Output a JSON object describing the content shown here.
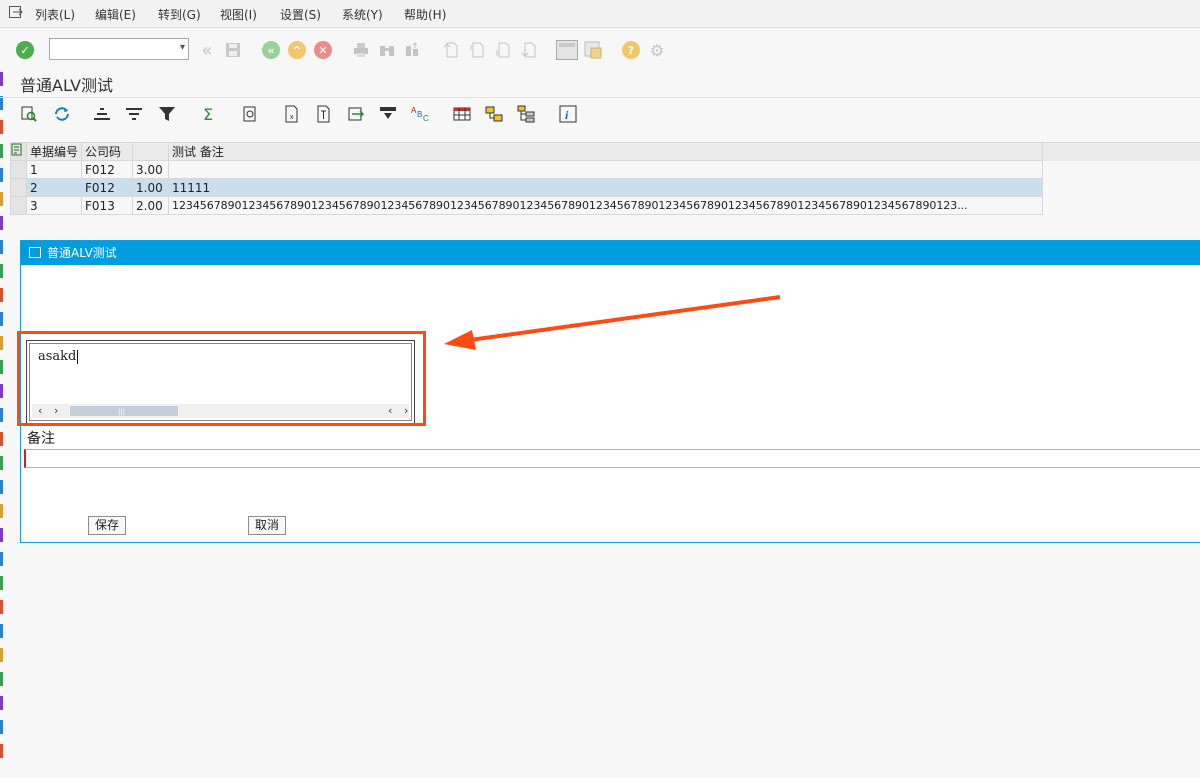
{
  "menu": {
    "items": [
      "列表(L)",
      "编辑(E)",
      "转到(G)",
      "视图(I)",
      "设置(S)",
      "系统(Y)",
      "帮助(H)"
    ]
  },
  "toolbar": {
    "command_field_value": "",
    "icons": [
      "enter-check",
      "dropdown",
      "back-double",
      "save",
      "back",
      "exit",
      "cancel",
      "print",
      "find",
      "find-next",
      "first-page",
      "prev-page",
      "next-page",
      "last-page",
      "layout",
      "create-session",
      "help",
      "settings"
    ]
  },
  "page": {
    "title": "普通ALV测试"
  },
  "alv": {
    "icons": [
      "details",
      "refresh",
      "sort-asc",
      "sort-desc",
      "filter",
      "sum",
      "print-preview",
      "excel",
      "word",
      "export",
      "layout-select",
      "abc-analysis",
      "table-view",
      "graph",
      "tree",
      "info"
    ],
    "columns": [
      "单据编号",
      "公司码",
      "",
      "测试 备注"
    ],
    "rows": [
      [
        "1",
        "F012",
        "3.00",
        ""
      ],
      [
        "2",
        "F012",
        "1.00",
        "11111"
      ],
      [
        "3",
        "F013",
        "2.00",
        "12345678901234567890123456789012345678901234567890123456789012345678901234567890123456789012345678901234567890123..."
      ]
    ]
  },
  "dialog": {
    "title": "普通ALV测试",
    "textedit_value": "asakd",
    "remark_label": "备注",
    "remark_value": "",
    "save_label": "保存",
    "cancel_label": "取消"
  },
  "colors": {
    "dialog_header": "#009de0",
    "highlight": "#ff4a12",
    "selected_row": "#c9dfef"
  }
}
